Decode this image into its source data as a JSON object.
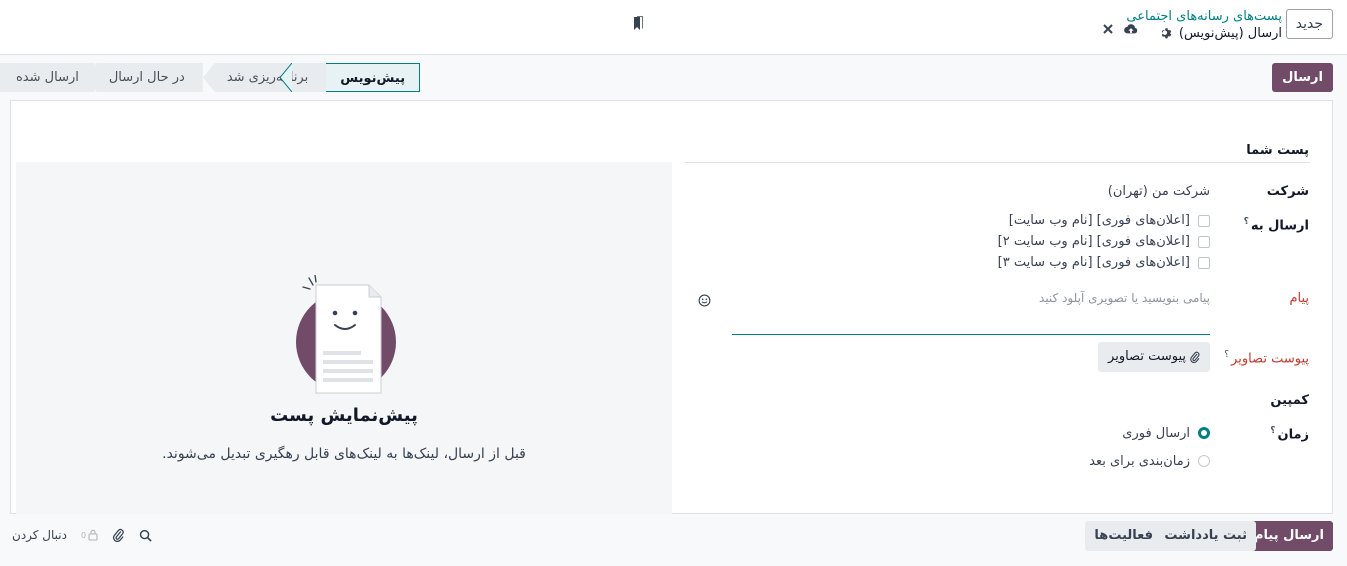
{
  "topbar": {
    "new_button": "جدید",
    "breadcrumb_parent": "پست‌های رسانه‌های اجتماعی",
    "breadcrumb_current": "ارسال (پیش‌نویس)"
  },
  "actionbar": {
    "send_button": "ارسال",
    "stages": [
      {
        "label": "پیش‌نویس",
        "active": true
      },
      {
        "label": "برنامه‌ریزی شد",
        "active": false
      },
      {
        "label": "در حال ارسال",
        "active": false
      },
      {
        "label": "ارسال شده",
        "active": false
      }
    ]
  },
  "form": {
    "section_title": "پست شما",
    "company_label": "شرکت",
    "company_value": "شرکت من (تهران)",
    "post_to_label": "ارسال به",
    "help_mark": "؟",
    "accounts": [
      "[اعلان‌های فوری] [نام وب سایت]",
      "[اعلان‌های فوری] [نام وب سایت ۲]",
      "[اعلان‌های فوری] [نام وب سایت ۳]"
    ],
    "message_label": "پیام",
    "message_placeholder": "پیامی بنویسید یا تصویری آپلود کنید",
    "images_label": "پیوست تصاویر",
    "attach_button": "پیوست تصاویر",
    "campaign_label": "کمپین",
    "when_label": "زمان",
    "when_options": [
      "ارسال فوری",
      "زمان‌بندی برای بعد"
    ],
    "when_selected": 0
  },
  "preview": {
    "title": "پیش‌نمایش پست",
    "subtitle": "قبل از ارسال، لینک‌ها به لینک‌های قابل رهگیری تبدیل می‌شوند."
  },
  "chatter": {
    "send_message": "ارسال پیام",
    "log_note": "ثبت یادداشت",
    "activities": "فعالیت‌ها",
    "followers_count": "0",
    "follow": "دنبال کردن"
  },
  "colors": {
    "primary": "#714b67",
    "accent": "#017e84"
  }
}
